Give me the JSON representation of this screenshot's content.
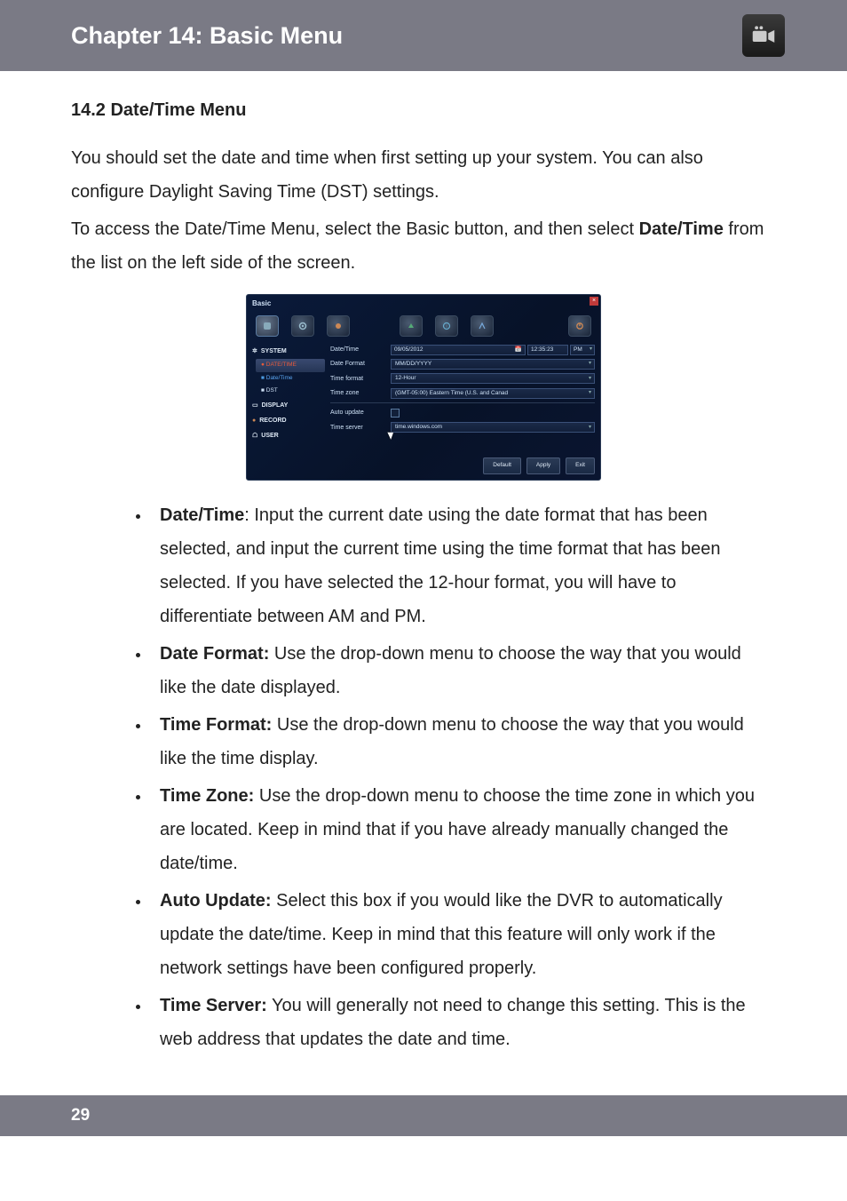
{
  "header": {
    "title": "Chapter 14: Basic Menu"
  },
  "section": {
    "title": "14.2 Date/Time Menu",
    "intro1": "You should set the date and time when first setting up your system. You can also configure Daylight Saving Time (DST) settings.",
    "intro2_a": "To access the Date/Time Menu, select the Basic button, and then select ",
    "intro2_bold": "Date/Time",
    "intro2_b": " from the list on the left side of the screen."
  },
  "dvr": {
    "title": "Basic",
    "sidebar": {
      "system": "SYSTEM",
      "datetime_tab": "DATE/TIME",
      "datetime_sub": "Date/Time",
      "dst": "DST",
      "display": "DISPLAY",
      "record": "RECORD",
      "user": "USER"
    },
    "rows": {
      "datetime": {
        "label": "Date/Time",
        "date": "09/05/2012",
        "time": "12:35:23",
        "ampm": "PM"
      },
      "dateformat": {
        "label": "Date Format",
        "value": "MM/DD/YYYY"
      },
      "timeformat": {
        "label": "Time format",
        "value": "12-Hour"
      },
      "timezone": {
        "label": "Time zone",
        "value": "(GMT-05:00) Eastern Time (U.S. and Canad"
      },
      "autoupdate": {
        "label": "Auto update"
      },
      "timeserver": {
        "label": "Time server",
        "value": "time.windows.com"
      }
    },
    "buttons": {
      "default": "Default",
      "apply": "Apply",
      "exit": "Exit"
    }
  },
  "bullets": [
    {
      "term": "Date/Time",
      "text": ": Input the current date using the date format that has been selected, and input the current time using the time format that has been selected. If you have selected the 12-hour format, you will have to differentiate between AM and PM."
    },
    {
      "term": "Date Format:",
      "text": " Use the drop-down menu to choose the way that you would like the date displayed."
    },
    {
      "term": "Time Format:",
      "text": " Use the drop-down menu to choose the way that you would like the time display."
    },
    {
      "term": "Time Zone:",
      "text": " Use the drop-down menu to choose the time zone in which you are located. Keep in mind that if you have already manually changed the date/time."
    },
    {
      "term": "Auto Update:",
      "text": " Select this box if you would like the DVR to automatically update the date/time. Keep in mind that this feature will only work if the network settings have been configured properly."
    },
    {
      "term": "Time Server:",
      "text": " You will generally not need to change this setting. This is the web address that updates the date and time."
    }
  ],
  "footer": {
    "page": "29"
  }
}
